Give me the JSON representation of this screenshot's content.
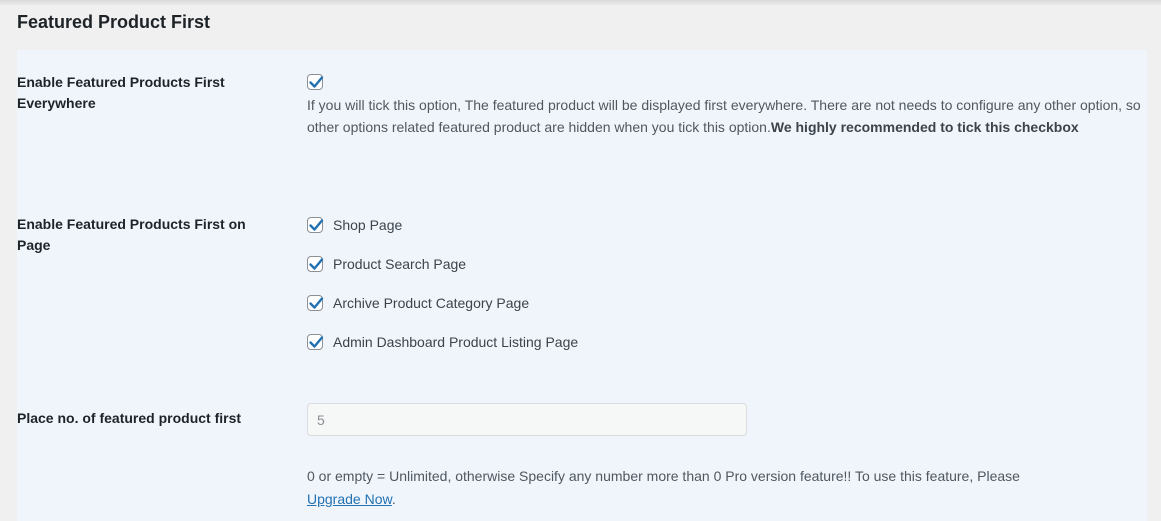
{
  "section": {
    "title": "Featured Product First"
  },
  "everywhere": {
    "label": "Enable Featured Products First Everywhere",
    "checked": true,
    "description": "If you will tick this option, The featured product will be displayed first everywhere. There are not needs to configure any other option, so other options related featured product are hidden when you tick this option.",
    "emphasis": "We highly recommended to tick this checkbox"
  },
  "on_page": {
    "label": "Enable Featured Products First on Page",
    "options": [
      {
        "label": "Shop Page",
        "checked": true
      },
      {
        "label": "Product Search Page",
        "checked": true
      },
      {
        "label": "Archive Product Category Page",
        "checked": true
      },
      {
        "label": "Admin Dashboard Product Listing Page",
        "checked": true
      }
    ]
  },
  "place_count": {
    "label": "Place no. of featured product first",
    "value": "5",
    "help_text": "0 or empty = Unlimited, otherwise Specify any number more than 0 Pro version feature!! To use this feature, Please",
    "link_label": "Upgrade Now",
    "trailing": "."
  },
  "colors": {
    "check": "#2271b1",
    "panel_bg": "#f0f5fc",
    "page_bg": "#f0f0f1",
    "link": "#2271b1"
  }
}
